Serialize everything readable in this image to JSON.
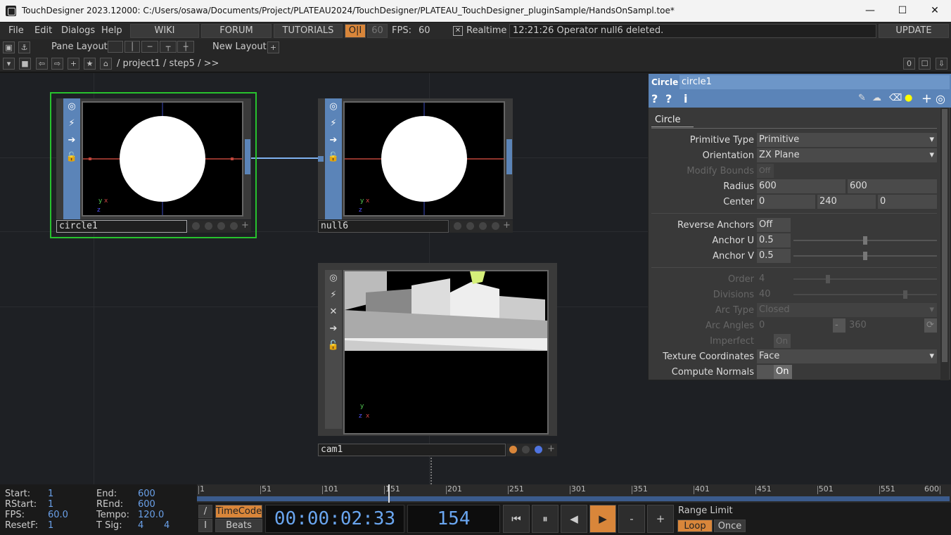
{
  "window": {
    "title": "TouchDesigner 2023.12000: C:/Users/osawa/Documents/Project/PLATEAU2024/TouchDesigner/PLATEAU_TouchDesigner_pluginSample/HandsOnSampl.toe*",
    "minimize": "—",
    "maximize": "☐",
    "close": "✕"
  },
  "menubar": {
    "items": [
      "File",
      "Edit",
      "Dialogs",
      "Help"
    ],
    "wiki": "WIKI",
    "forum": "FORUM",
    "tutorials": "TUTORIALS",
    "oi": "O|I",
    "fps_target": "60",
    "fps_label": "FPS:",
    "fps_value": "60",
    "realtime_check": "✕",
    "realtime_label": "Realtime",
    "status": "12:21:26 Operator null6 deleted.",
    "update": "UPDATE"
  },
  "toolbar2": {
    "pane_layout": "Pane Layout",
    "new_layout": "New Layout",
    "add": "+"
  },
  "toolbar3": {
    "path": "/ project1 / step5 / >>",
    "count": "0"
  },
  "nodes": {
    "circle1": {
      "name": "circle1"
    },
    "null6": {
      "name": "null6"
    },
    "cam1": {
      "name": "cam1"
    }
  },
  "params": {
    "op_type": "Circle",
    "op_name": "circle1",
    "page_tab": "Circle",
    "rows": {
      "primitive_type": {
        "label": "Primitive Type",
        "value": "Primitive"
      },
      "orientation": {
        "label": "Orientation",
        "value": "ZX Plane"
      },
      "modify_bounds": {
        "label": "Modify Bounds",
        "value": "Off"
      },
      "radius": {
        "label": "Radius",
        "x": "600",
        "y": "600"
      },
      "center": {
        "label": "Center",
        "x": "0",
        "y": "240",
        "z": "0"
      },
      "reverse_anchors": {
        "label": "Reverse Anchors",
        "value": "Off"
      },
      "anchor_u": {
        "label": "Anchor U",
        "value": "0.5",
        "level": 0.5
      },
      "anchor_v": {
        "label": "Anchor V",
        "value": "0.5",
        "level": 0.5
      },
      "order": {
        "label": "Order",
        "value": "4"
      },
      "divisions": {
        "label": "Divisions",
        "value": "40"
      },
      "arc_type": {
        "label": "Arc Type",
        "value": "Closed"
      },
      "arc_angles": {
        "label": "Arc Angles",
        "start": "0",
        "end": "360"
      },
      "imperfect": {
        "label": "Imperfect",
        "value": "On"
      },
      "texture_coordinates": {
        "label": "Texture Coordinates",
        "value": "Face"
      },
      "compute_normals": {
        "label": "Compute Normals",
        "value": "On"
      }
    }
  },
  "timeline": {
    "ticks": [
      "1",
      "51",
      "101",
      "151",
      "201",
      "251",
      "301",
      "351",
      "401",
      "451",
      "501",
      "551",
      "600"
    ],
    "start_label": "Start:",
    "start": "1",
    "end_label": "End:",
    "end": "600",
    "rstart_label": "RStart:",
    "rstart": "1",
    "rend_label": "REnd:",
    "rend": "600",
    "fps_label": "FPS:",
    "fps": "60.0",
    "tempo_label": "Tempo:",
    "tempo": "120.0",
    "resetf_label": "ResetF:",
    "resetf": "1",
    "tsig_label": "T Sig:",
    "tsig_a": "4",
    "tsig_b": "4",
    "timecode": "TimeCode",
    "beats": "Beats",
    "time": "00:00:02:33",
    "frame": "154",
    "range_limit": "Range Limit",
    "loop": "Loop",
    "once": "Once",
    "slash": "/",
    "bar": "I",
    "btn_start": "⏮",
    "btn_pause": "⏸",
    "btn_back": "◀",
    "btn_play": "▶",
    "btn_minus": "-",
    "btn_plus": "+"
  },
  "colors": {
    "accent_orange": "#d9863a",
    "selection_green": "#27c22e",
    "strip_blue": "#5b84b8",
    "value_blue": "#6aa0e8"
  }
}
